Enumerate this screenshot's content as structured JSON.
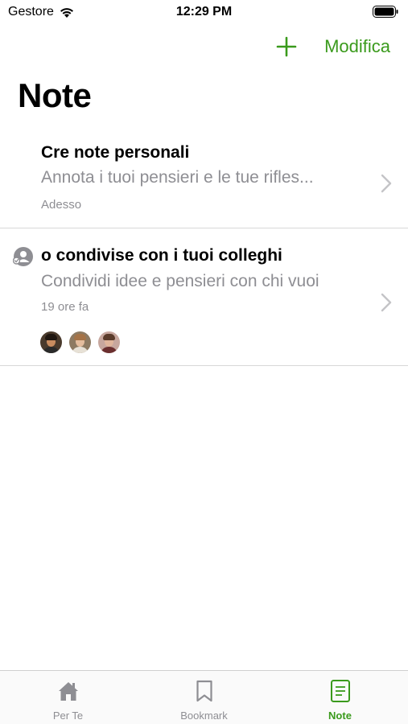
{
  "status_bar": {
    "carrier": "Gestore",
    "time": "12:29 PM"
  },
  "nav": {
    "add_icon": "plus-icon",
    "edit_label": "Modifica"
  },
  "page": {
    "title": "Note"
  },
  "notes": [
    {
      "title": "Cre note personali",
      "description": "Annota i tuoi pensieri e le tue rifles...",
      "time": "Adesso"
    },
    {
      "title": "o condivise con i tuoi colleghi",
      "description": "Condividi idee e pensieri con chi vuoi",
      "time": "19 ore fa",
      "shared_icon": "shared-users-icon"
    }
  ],
  "tabs": [
    {
      "label": "Per Te",
      "icon": "home-icon",
      "active": false
    },
    {
      "label": "Bookmark",
      "icon": "bookmark-icon",
      "active": false
    },
    {
      "label": "Note",
      "icon": "note-icon",
      "active": true
    }
  ],
  "colors": {
    "accent": "#3a9a1c",
    "secondary_text": "#8e8e93",
    "divider": "#d8d8d8"
  }
}
